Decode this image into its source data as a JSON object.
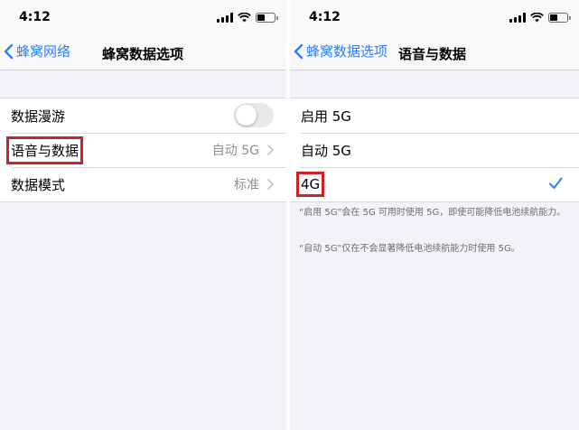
{
  "status": {
    "time": "4:12"
  },
  "left": {
    "nav": {
      "back_label": "蜂窝网络",
      "title": "蜂窝数据选项"
    },
    "rows": [
      {
        "label": "数据漫游",
        "type": "toggle",
        "on": false
      },
      {
        "label": "语音与数据",
        "detail": "自动 5G"
      },
      {
        "label": "数据模式",
        "detail": "标准"
      }
    ]
  },
  "right": {
    "nav": {
      "back_label": "蜂窝数据选项",
      "title": "语音与数据"
    },
    "options": [
      {
        "label": "启用 5G",
        "selected": false
      },
      {
        "label": "自动 5G",
        "selected": false
      },
      {
        "label": "4G",
        "selected": true
      }
    ],
    "footer": [
      "“启用 5G”会在 5G 可用时使用 5G，即使可能降低电池续航能力。",
      "“自动 5G”仅在不会显著降低电池续航能力时使用 5G。"
    ]
  },
  "colors": {
    "accent": "#2f7ef5",
    "highlight": "#d32027"
  },
  "icons": [
    "signal-icon",
    "wifi-icon",
    "battery-icon",
    "chevron-left-icon",
    "chevron-right-icon",
    "checkmark-icon"
  ]
}
